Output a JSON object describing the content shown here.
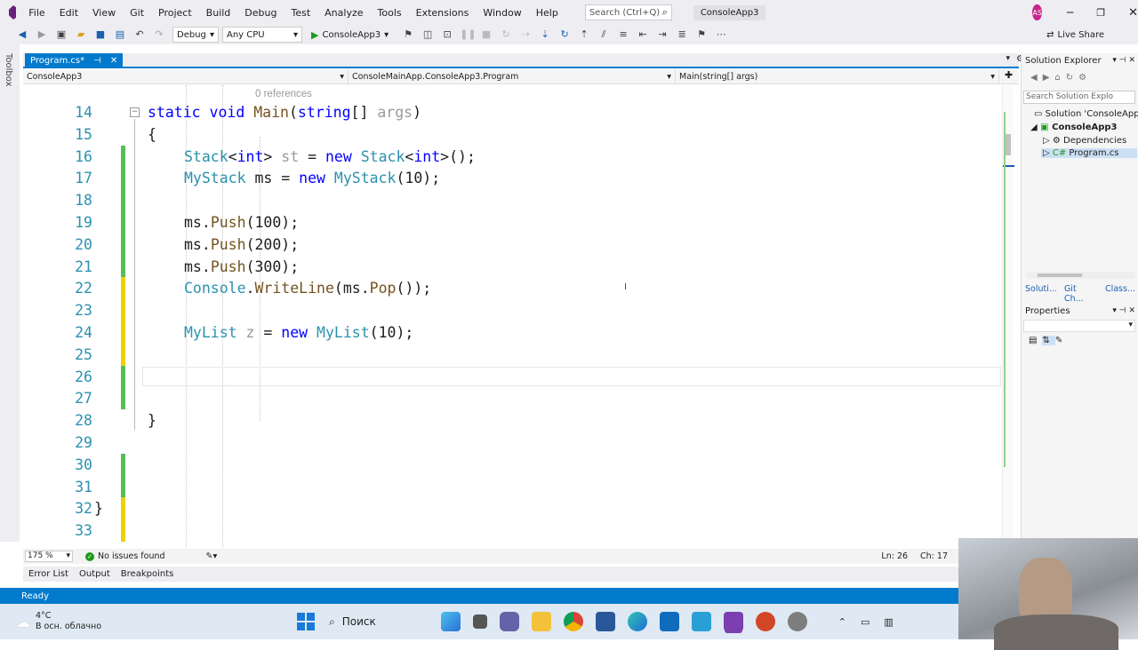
{
  "menu": {
    "items": [
      "File",
      "Edit",
      "View",
      "Git",
      "Project",
      "Build",
      "Debug",
      "Test",
      "Analyze",
      "Tools",
      "Extensions",
      "Window",
      "Help"
    ],
    "search_placeholder": "Search (Ctrl+Q)",
    "solution_name": "ConsoleApp3",
    "avatar_initials": "AS"
  },
  "toolbar": {
    "config": "Debug",
    "platform": "Any CPU",
    "run_target": "ConsoleApp3",
    "live_share": "Live Share"
  },
  "left_strip": {
    "label": "Toolbox"
  },
  "doc_tab": {
    "label": "Program.cs*"
  },
  "navbar": {
    "project": "ConsoleApp3",
    "class": "ConsoleMainApp.ConsoleApp3.Program",
    "member": "Main(string[] args)"
  },
  "editor": {
    "references": "0 references",
    "lines": [
      {
        "n": "14",
        "tokens": [
          [
            "kw",
            "static "
          ],
          [
            "kw",
            "void "
          ],
          [
            "fn",
            "Main"
          ],
          [
            "cm",
            "("
          ],
          [
            "kw",
            "string"
          ],
          [
            "cm",
            "[] "
          ],
          [
            "gray",
            "args"
          ],
          [
            "cm",
            ")"
          ]
        ],
        "indent": 3,
        "mark": ""
      },
      {
        "n": "15",
        "tokens": [
          [
            "cm",
            "{"
          ]
        ],
        "indent": 3,
        "mark": ""
      },
      {
        "n": "16",
        "tokens": [
          [
            "ty",
            "Stack"
          ],
          [
            "cm",
            "<"
          ],
          [
            "kw",
            "int"
          ],
          [
            "cm",
            "> "
          ],
          [
            "gray",
            "st"
          ],
          [
            "cm",
            " = "
          ],
          [
            "kw",
            "new "
          ],
          [
            "ty",
            "Stack"
          ],
          [
            "cm",
            "<"
          ],
          [
            "kw",
            "int"
          ],
          [
            "cm",
            ">();"
          ]
        ],
        "indent": 4,
        "mark": "green"
      },
      {
        "n": "17",
        "tokens": [
          [
            "ty",
            "MyStack "
          ],
          [
            "cm",
            "ms = "
          ],
          [
            "kw",
            "new "
          ],
          [
            "ty",
            "MyStack"
          ],
          [
            "cm",
            "(10);"
          ]
        ],
        "indent": 4,
        "mark": "green"
      },
      {
        "n": "18",
        "tokens": [],
        "indent": 4,
        "mark": "green"
      },
      {
        "n": "19",
        "tokens": [
          [
            "cm",
            "ms."
          ],
          [
            "fn",
            "Push"
          ],
          [
            "cm",
            "(100);"
          ]
        ],
        "indent": 4,
        "mark": "green"
      },
      {
        "n": "20",
        "tokens": [
          [
            "cm",
            "ms."
          ],
          [
            "fn",
            "Push"
          ],
          [
            "cm",
            "(200);"
          ]
        ],
        "indent": 4,
        "mark": "green"
      },
      {
        "n": "21",
        "tokens": [
          [
            "cm",
            "ms."
          ],
          [
            "fn",
            "Push"
          ],
          [
            "cm",
            "(300);"
          ]
        ],
        "indent": 4,
        "mark": "green"
      },
      {
        "n": "22",
        "tokens": [
          [
            "ty",
            "Console"
          ],
          [
            "cm",
            "."
          ],
          [
            "fn",
            "WriteLine"
          ],
          [
            "cm",
            "(ms."
          ],
          [
            "fn",
            "Pop"
          ],
          [
            "cm",
            "());"
          ]
        ],
        "indent": 4,
        "mark": "yellow"
      },
      {
        "n": "23",
        "tokens": [],
        "indent": 4,
        "mark": "yellow"
      },
      {
        "n": "24",
        "tokens": [
          [
            "ty",
            "MyList "
          ],
          [
            "gray",
            "z"
          ],
          [
            "cm",
            " = "
          ],
          [
            "kw",
            "new "
          ],
          [
            "ty",
            "MyList"
          ],
          [
            "cm",
            "(10);"
          ]
        ],
        "indent": 4,
        "mark": "yellow"
      },
      {
        "n": "25",
        "tokens": [],
        "indent": 4,
        "mark": "yellow"
      },
      {
        "n": "26",
        "tokens": [],
        "indent": 4,
        "mark": "green"
      },
      {
        "n": "27",
        "tokens": [],
        "indent": 4,
        "mark": "green"
      },
      {
        "n": "28",
        "tokens": [
          [
            "cm",
            "}"
          ]
        ],
        "indent": 3,
        "mark": ""
      },
      {
        "n": "29",
        "tokens": [],
        "indent": 2,
        "mark": ""
      },
      {
        "n": "30",
        "tokens": [],
        "indent": 2,
        "mark": "green"
      },
      {
        "n": "31",
        "tokens": [],
        "indent": 2,
        "mark": "green"
      },
      {
        "n": "32",
        "tokens": [
          [
            "cm",
            "}"
          ]
        ],
        "indent": 2,
        "mark": "yellow"
      },
      {
        "n": "33",
        "tokens": [],
        "indent": 2,
        "mark": "yellow"
      }
    ]
  },
  "status_line": {
    "zoom": "175 %",
    "issues": "No issues found",
    "position_line": "Ln: 26",
    "position_char": "Ch: 17"
  },
  "bottom_tabs": [
    "Error List",
    "Output",
    "Breakpoints"
  ],
  "statusbar": {
    "text": "Ready"
  },
  "solution_explorer": {
    "title": "Solution Explorer",
    "search_placeholder": "Search Solution Explo",
    "items": [
      "Solution 'ConsoleApp",
      "ConsoleApp3",
      "Dependencies",
      "Program.cs"
    ],
    "tabs": [
      "Soluti...",
      "Git Ch...",
      "Class..."
    ]
  },
  "properties": {
    "title": "Properties"
  },
  "taskbar": {
    "weather_temp": "4°C",
    "weather_desc": "В осн. облачно",
    "search_label": "Поиск"
  }
}
